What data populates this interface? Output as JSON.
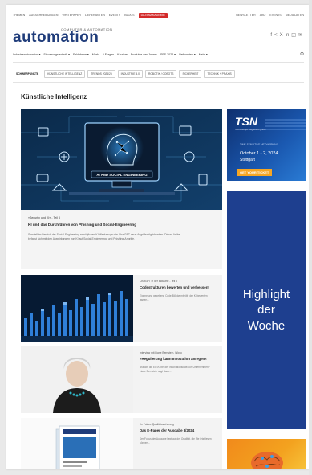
{
  "topnav": {
    "links": [
      "Themen",
      "Ausschreibungen",
      "Whitepaper",
      "Lieferanten",
      "Events",
      "Blogs",
      "Datenakademie"
    ],
    "highlight_label": "Datenakademie",
    "right_links": [
      "Newsletter",
      "Abo",
      "Events",
      "Mediadaten"
    ]
  },
  "logo": {
    "sub": "Computer & Automation",
    "word": "automation"
  },
  "social_icons": [
    "facebook-icon",
    "share-icon",
    "x-icon",
    "linkedin-icon",
    "instagram-icon",
    "email-icon"
  ],
  "mainnav": {
    "items": [
      "Industrieautomation ▾",
      "Steuerungstechnik ▾",
      "Feldebene ▾",
      "Markt",
      "5 Fragen",
      "Karriere",
      "Produkte des Jahres",
      "SPS 2024 ▾",
      "Lieferanten ▾",
      "Mehr ▾"
    ],
    "search_icon": "search-icon"
  },
  "tabs": [
    "Schwerpunkte",
    "Künstliche Intelligenz",
    "Trends 2024/25",
    "Industrie 4.0",
    "Robotik / Cobots",
    "Sicherheit",
    "Technik + Praxis"
  ],
  "section_title": "Künstliche Intelligenz",
  "hero": {
    "image_caption": "AI AND SOCIAL ENGINEERING",
    "kicker": "»Security und KI« - Teil 3",
    "title": "KI und das Durchführen von Phishing und Social-Engineering",
    "teaser": "Speziell im Bereich der Social-Engineering ermöglichen KI-Werkzeuge wie ChatGPT neue Angriffsmöglichkeiten. Dieser Artikel befasst sich mit den Auswirkungen von KI auf Social-Engineering- und Phishing-Angriffe."
  },
  "articles": [
    {
      "kicker": "ChatGPT in der Industrie - Teil 6",
      "title": "Codestrukturen bewerten und verbessern",
      "teaser": "Eigene und gegebene Code-Blöcke mithilfe der KI bewerten lassen..."
    },
    {
      "kicker": "Interview mit Liane Bernstein, Wipro",
      "title": "»Regulierung kann Innovation anregen«",
      "teaser": "Braucht die EU-KI bei der Innovationskraft von Unternehmen? Liane Bernstein sagt dazu..."
    },
    {
      "kicker": "Ihr Fokus: Qualitätssicherung",
      "title": "Das E-Paper der Ausgabe 8/2024",
      "teaser": "Der Fokus der Ausgabe liegt auf der Qualität, die Sie jetzt lesen können..."
    }
  ],
  "sidebar": {
    "tsn": {
      "brand": "TSN",
      "brand_sub": "Technologie-Begleitkongress",
      "header": "TIME-SENSITIVE NETWORKING",
      "date": "October 1 - 2, 2024",
      "city": "Stuttgart",
      "cta": "GET YOUR TICKET"
    },
    "highlight": "Highlight der Woche"
  },
  "colors": {
    "brand": "#1f3c7a",
    "red": "#d32a2a",
    "highlight": "#1e3f8f",
    "cta": "#f6a623"
  }
}
